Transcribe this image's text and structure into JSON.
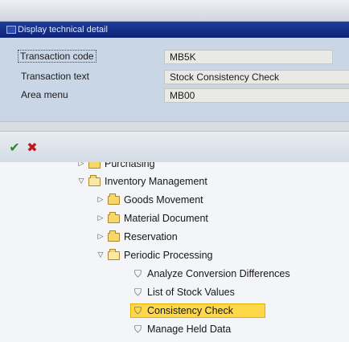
{
  "window": {
    "title": "Display technical details",
    "title_visible": "Display technical detail"
  },
  "details": {
    "transaction_code_label": "Transaction code",
    "transaction_code_value": "MB5K",
    "transaction_text_label": "Transaction text",
    "transaction_text_value": "Stock Consistency Check",
    "area_menu_label": "Area menu",
    "area_menu_value": "MB00"
  },
  "toolbar": {
    "ok_icon": "check-icon",
    "cancel_icon": "x-icon"
  },
  "tree": {
    "nodes": [
      {
        "label": "Purchasing",
        "state": "collapsed",
        "type": "folder"
      },
      {
        "label": "Inventory Management",
        "state": "expanded",
        "type": "folder"
      },
      {
        "label": "Goods Movement",
        "state": "collapsed",
        "type": "folder"
      },
      {
        "label": "Material Document",
        "state": "collapsed",
        "type": "folder"
      },
      {
        "label": "Reservation",
        "state": "collapsed",
        "type": "folder"
      },
      {
        "label": "Periodic Processing",
        "state": "expanded",
        "type": "folder"
      },
      {
        "label": "Analyze Conversion Differences",
        "type": "transaction"
      },
      {
        "label": "List of Stock Values",
        "type": "transaction"
      },
      {
        "label": "Consistency Check",
        "type": "transaction",
        "selected": true
      },
      {
        "label": "Manage Held Data",
        "type": "transaction"
      }
    ]
  },
  "colors": {
    "titlebar": "#0d2274",
    "details_bg": "#c9d6e6",
    "selection": "#ffd84a",
    "ok": "#2f8a1e",
    "cancel": "#c0181e"
  }
}
